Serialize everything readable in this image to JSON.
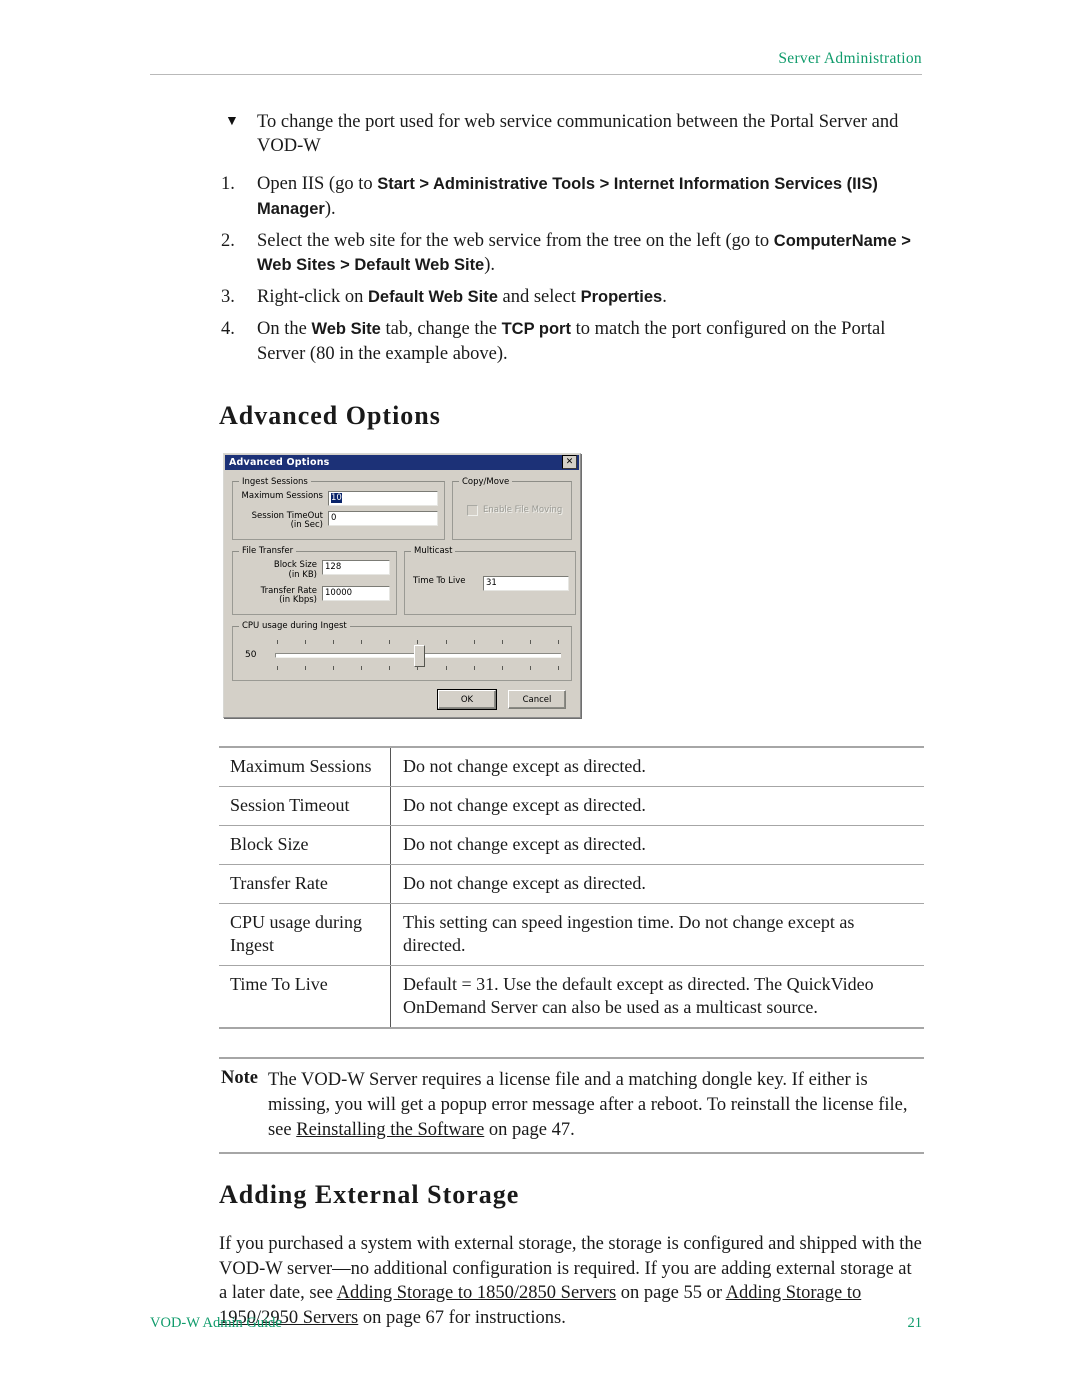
{
  "header": {
    "running_head": "Server Administration"
  },
  "footer": {
    "guide": "VOD-W Admin Guide",
    "page_number": "21"
  },
  "task": {
    "bullet_glyph": "▼",
    "heading": "To change the port used for web service communication between the Portal Server and VOD-W",
    "steps": [
      {
        "num": "1.",
        "parts": [
          {
            "t": "Open IIS (go to ",
            "bold": false
          },
          {
            "t": "Start > Administrative Tools > Internet Information Services (IIS) Manager",
            "bold": true
          },
          {
            "t": ").",
            "bold": false
          }
        ]
      },
      {
        "num": "2.",
        "parts": [
          {
            "t": "Select the web site for the web service from the tree on the left (go to ",
            "bold": false
          },
          {
            "t": "ComputerName > Web Sites > Default Web Site",
            "bold": true
          },
          {
            "t": ").",
            "bold": false
          }
        ]
      },
      {
        "num": "3.",
        "parts": [
          {
            "t": "Right-click on ",
            "bold": false
          },
          {
            "t": "Default Web Site",
            "bold": true
          },
          {
            "t": " and select ",
            "bold": false
          },
          {
            "t": "Properties",
            "bold": true
          },
          {
            "t": ".",
            "bold": false
          }
        ]
      },
      {
        "num": "4.",
        "parts": [
          {
            "t": "On the ",
            "bold": false
          },
          {
            "t": "Web Site",
            "bold": true
          },
          {
            "t": " tab, change the ",
            "bold": false
          },
          {
            "t": "TCP port",
            "bold": true
          },
          {
            "t": " to match the port configured on the Portal Server (80 in the example above).",
            "bold": false
          }
        ]
      }
    ]
  },
  "section_advanced_options": {
    "heading": "Advanced Options"
  },
  "dialog": {
    "title": "Advanced Options",
    "close_label": "✕",
    "ingest_sessions": {
      "legend": "Ingest Sessions",
      "max_sessions_label": "Maximum Sessions",
      "max_sessions_value": "10",
      "session_timeout_label_line1": "Session TimeOut",
      "session_timeout_label_line2": "(in Sec)",
      "session_timeout_value": "0"
    },
    "copy_move": {
      "legend": "Copy/Move",
      "checkbox_label": "Enable File Moving",
      "checked": false,
      "disabled": true
    },
    "file_transfer": {
      "legend": "File Transfer",
      "block_size_label_line1": "Block Size",
      "block_size_label_line2": "(in KB)",
      "block_size_value": "128",
      "transfer_rate_label_line1": "Transfer Rate",
      "transfer_rate_label_line2": "(in Kbps)",
      "transfer_rate_value": "10000"
    },
    "multicast": {
      "legend": "Multicast",
      "ttl_label": "Time To Live",
      "ttl_value": "31"
    },
    "cpu_usage": {
      "legend": "CPU usage during Ingest",
      "value": "50",
      "tick_count": 11,
      "thumb_percent": 50
    },
    "buttons": {
      "ok": "OK",
      "cancel": "Cancel"
    },
    "colors": {
      "titlebar": "#1c3177",
      "face": "#d4d0c8",
      "selection": "#0a246a"
    }
  },
  "spec_table": {
    "rows": [
      {
        "key": "Maximum Sessions",
        "desc": "Do not change except as directed."
      },
      {
        "key": "Session Timeout",
        "desc": "Do not change except as directed."
      },
      {
        "key": "Block Size",
        "desc": "Do not change except as directed."
      },
      {
        "key": "Transfer Rate",
        "desc": "Do not change except as directed."
      },
      {
        "key": "CPU usage during Ingest",
        "desc": "This setting can speed ingestion time. Do not change except as directed."
      },
      {
        "key": "Time To Live",
        "desc": "Default = 31. Use the default except as directed. The QuickVideo OnDemand Server can also be used as a multicast source."
      }
    ]
  },
  "note": {
    "lead": "Note",
    "parts": [
      {
        "t": "The VOD-W Server requires a license file and a matching dongle key. If either is missing, you will get a popup error message after a reboot. To reinstall the license file, see ",
        "link": false
      },
      {
        "t": "Reinstalling the Software",
        "link": true
      },
      {
        "t": " on page 47.",
        "link": false
      }
    ]
  },
  "section_adding_external_storage": {
    "heading": "Adding External Storage",
    "paragraph_parts": [
      {
        "t": "If you purchased a system with external storage, the storage is configured and shipped with the VOD-W server—no additional configuration is required. If you are adding external storage at a later date, see ",
        "link": false
      },
      {
        "t": "Adding Storage to 1850/2850 Servers",
        "link": true
      },
      {
        "t": " on page 55 or ",
        "link": false
      },
      {
        "t": "Adding Storage to 1950/2950 Servers",
        "link": true
      },
      {
        "t": " on page 67 for instructions.",
        "link": false
      }
    ]
  },
  "colors": {
    "accent_green": "#0f9b6b",
    "rule_gray": "#a6a6a6"
  }
}
